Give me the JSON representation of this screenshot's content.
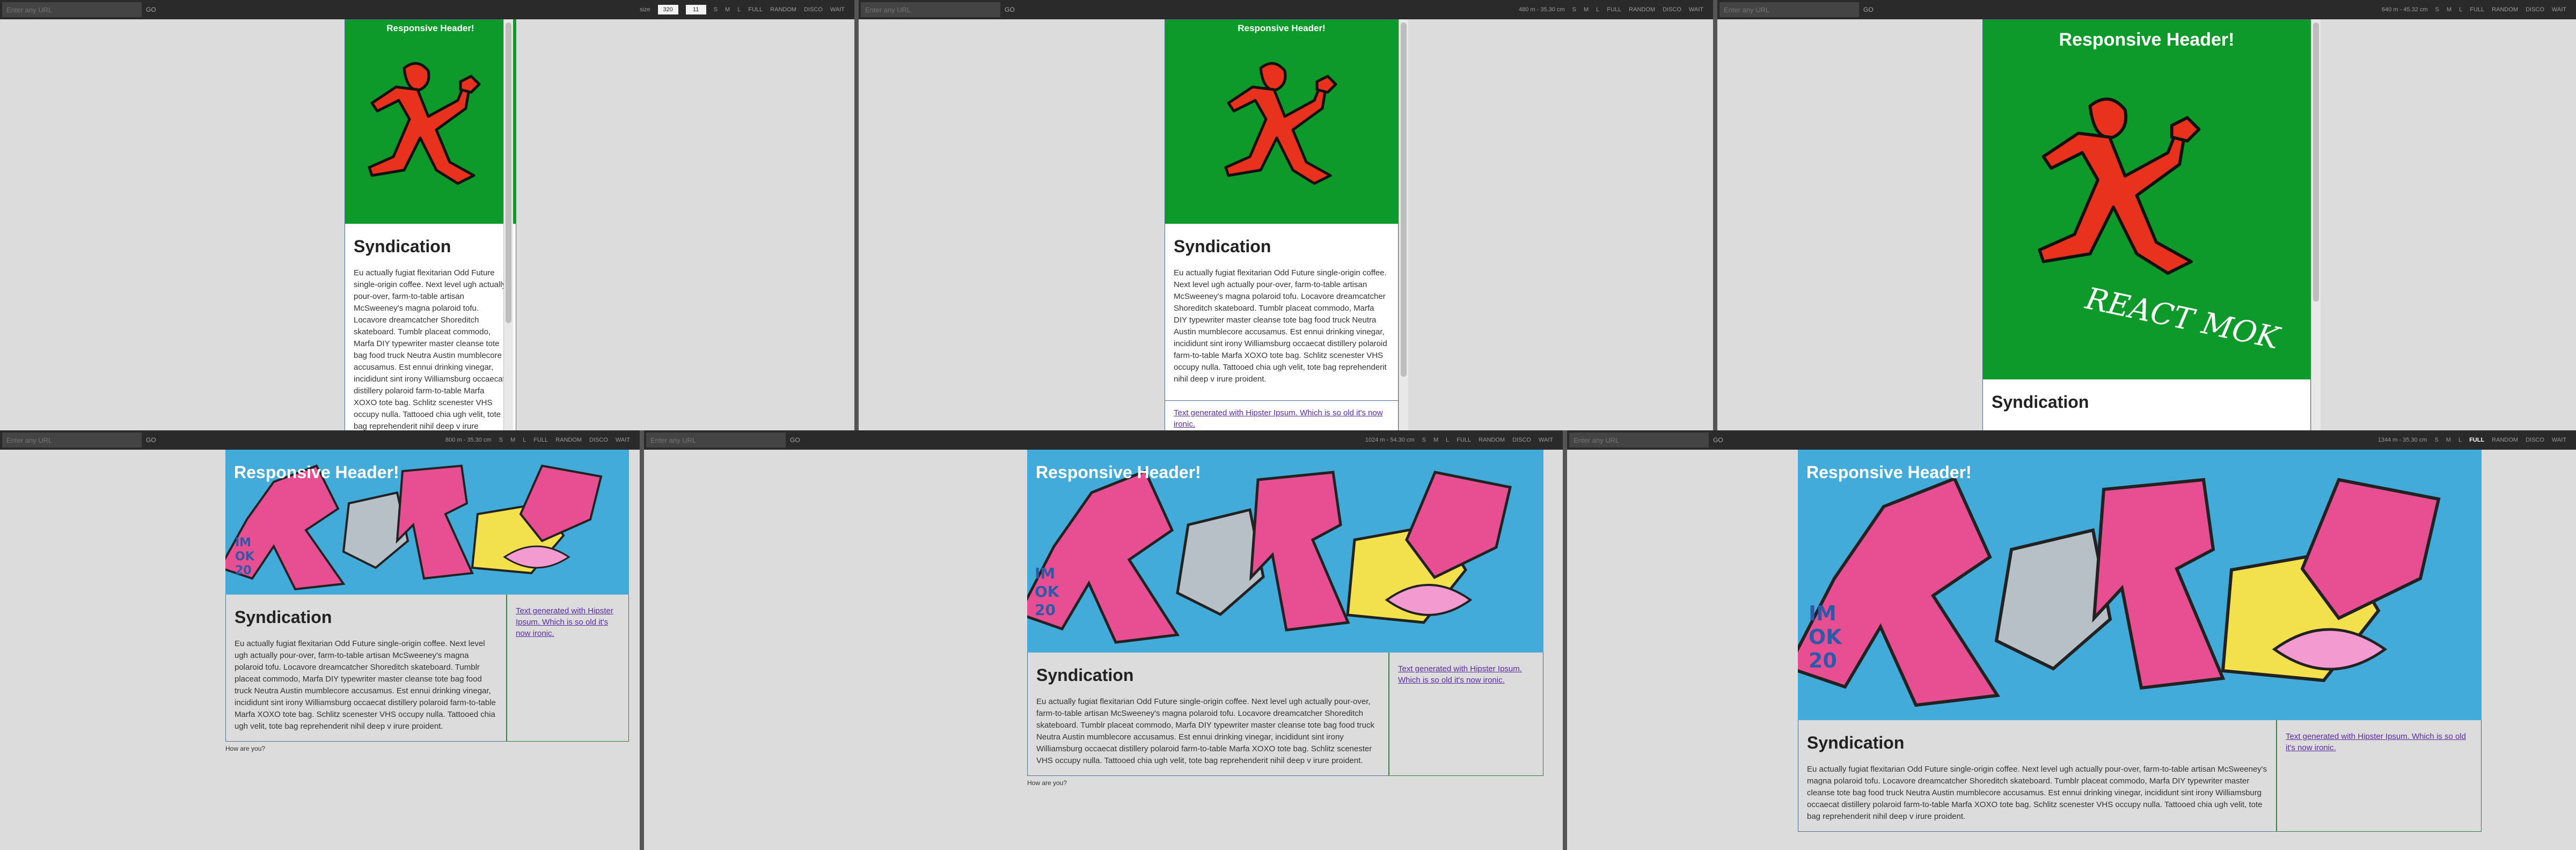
{
  "toolbar": {
    "url_placeholder": "Enter any URL",
    "go_label": "GO",
    "size_label": "size",
    "panes": [
      {
        "width": "320",
        "height": "35.36 ~ 4.70",
        "zoom": "11"
      },
      {
        "width": "",
        "height": "480 m - 35.30 cm",
        "zoom": ""
      },
      {
        "width": "",
        "height": "640 m - 45.32 cm",
        "zoom": ""
      },
      {
        "width": "",
        "height": "800 m - 35.30 cm",
        "zoom": ""
      },
      {
        "width": "",
        "height": "1024 m - 54.30 cm",
        "zoom": ""
      },
      {
        "width": "",
        "height": "1344 m - 35.30 cm",
        "zoom": ""
      }
    ],
    "buttons": [
      "S",
      "M",
      "L",
      "FULL",
      "RANDOM",
      "DISCO",
      "WAIT"
    ]
  },
  "site": {
    "header_title": "Responsive Header!",
    "article_heading": "Syndication",
    "article_text": "Eu actually fugiat flexitarian Odd Future single-origin coffee. Next level ugh actually pour-over, farm-to-table artisan McSweeney's magna polaroid tofu. Locavore dreamcatcher Shoreditch skateboard. Tumblr placeat commodo, Marfa DIY typewriter master cleanse tote bag food truck Neutra Austin mumblecore accusamus. Est ennui drinking vinegar, incididunt sint irony Williamsburg occaecat distillery polaroid farm-to-table Marfa XOXO tote bag. Schlitz scenester VHS occupy nulla. Tattooed chia ugh velit, tote bag reprehenderit nihil deep v irure proident.",
    "aside_link_long": "Text generated with Hipster Ipsum. Which is so old it's now ironic.",
    "aside_link_short": "Text generated with Hipster Ipsum. Which is so old it's now ironic.",
    "footer_text": "How are you?",
    "secondary_text": "Text generated with Hipster Ipsum. Which is so old it's now ironic.",
    "logo_text": "REACT MOK"
  },
  "colors": {
    "header_green": "#0d9a2a",
    "figure_red": "#e8321e",
    "toolbar": "#2a2a2a",
    "link": "#5a2aa0"
  }
}
